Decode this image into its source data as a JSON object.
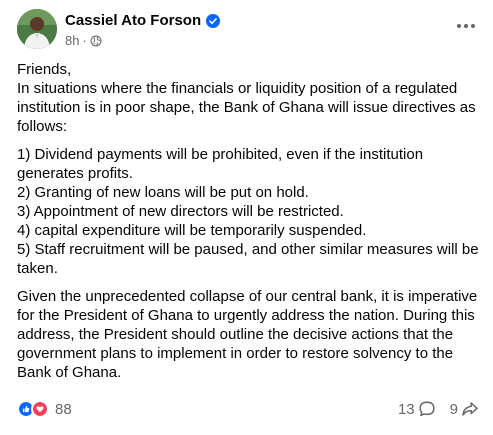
{
  "post": {
    "author": "Cassiel Ato Forson",
    "time": "8h",
    "meta_separator": "·",
    "more_label": "···",
    "paragraphs": [
      "Friends,\nIn situations where the financials or liquidity position of a regulated institution is in poor shape, the Bank of Ghana will issue directives as follows:",
      "1) Dividend payments will be prohibited, even if the institution generates profits.\n2) Granting of new loans will be put on hold.\n3) Appointment of new directors will be restricted.\n4) capital expenditure will be temporarily suspended.\n5) Staff recruitment will be paused, and other similar measures will be taken.",
      "Given the unprecedented collapse of our central bank, it is imperative for the President of Ghana to urgently address the nation. During this address, the President should outline the decisive actions that the government plans to implement in order to restore solvency to the Bank of Ghana."
    ]
  },
  "footer": {
    "reaction_count": "88",
    "comment_count": "13",
    "share_count": "9"
  },
  "icons": {
    "verified": "verified-badge-icon",
    "audience": "globe-icon",
    "more": "more-options-icon",
    "like": "like-reaction-icon",
    "love": "love-reaction-icon",
    "comment": "comment-icon",
    "share": "share-icon"
  },
  "colors": {
    "text": "#050505",
    "secondary_text": "#65676b",
    "facebook_blue": "#0866ff",
    "love_red": "#f33e58"
  }
}
